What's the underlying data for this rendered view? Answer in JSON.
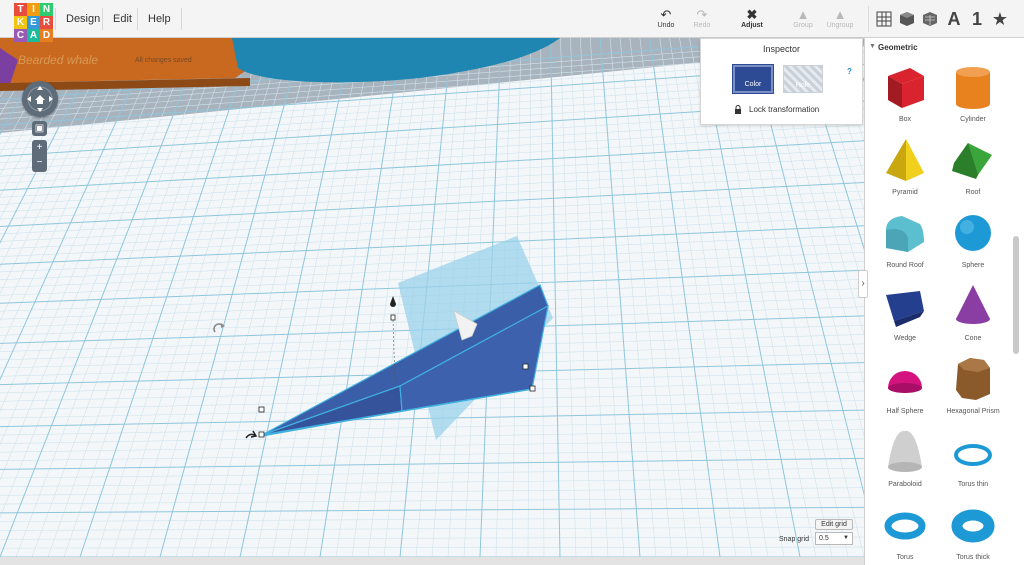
{
  "app": {
    "logo_letters": [
      "T",
      "I",
      "N",
      "K",
      "E",
      "R",
      "C",
      "A",
      "D"
    ],
    "logo_colors": [
      "#e74c3c",
      "#f39c12",
      "#2ecc71",
      "#f1c40f",
      "#3498db",
      "#e74c3c",
      "#9b59b6",
      "#1abc9c",
      "#e67e22"
    ]
  },
  "menu": {
    "design": "Design",
    "edit": "Edit",
    "help": "Help"
  },
  "toolbar": {
    "undo": "Undo",
    "redo": "Redo",
    "adjust": "Adjust",
    "group": "Group",
    "ungroup": "Ungroup",
    "letters_label": "A",
    "numbers_label": "1"
  },
  "project": {
    "title": "Bearded whale",
    "save_status": "All changes saved"
  },
  "inspector": {
    "title": "Inspector",
    "color_label": "Color",
    "hole_label": "Hole",
    "help": "?",
    "lock_label": "Lock transformation",
    "selected_color": "#2d4a95"
  },
  "grid": {
    "edit_label": "Edit grid",
    "snap_label": "Snap grid",
    "snap_value": "0.5"
  },
  "panel": {
    "section_title": "Geometric",
    "shapes": [
      {
        "name": "Box",
        "icon": "box-icon",
        "color": "#d9232e"
      },
      {
        "name": "Cylinder",
        "icon": "cylinder-icon",
        "color": "#e8821f"
      },
      {
        "name": "Pyramid",
        "icon": "pyramid-icon",
        "color": "#f1cf1d"
      },
      {
        "name": "Roof",
        "icon": "roof-icon",
        "color": "#3aa53a"
      },
      {
        "name": "Round Roof",
        "icon": "round-roof-icon",
        "color": "#5cbfd0"
      },
      {
        "name": "Sphere",
        "icon": "sphere-icon",
        "color": "#1d9ad6"
      },
      {
        "name": "Wedge",
        "icon": "wedge-icon",
        "color": "#253f8f"
      },
      {
        "name": "Cone",
        "icon": "cone-icon",
        "color": "#8a3da3"
      },
      {
        "name": "Half Sphere",
        "icon": "half-sphere-icon",
        "color": "#d4137f"
      },
      {
        "name": "Hexagonal Prism",
        "icon": "hexagonal-prism-icon",
        "color": "#8b5a2b"
      },
      {
        "name": "Paraboloid",
        "icon": "paraboloid-icon",
        "color": "#cfcfcf"
      },
      {
        "name": "Torus thin",
        "icon": "torus-thin-icon",
        "color": "#1d9ad6"
      },
      {
        "name": "Torus",
        "icon": "torus-icon",
        "color": "#1d9ad6"
      },
      {
        "name": "Torus thick",
        "icon": "torus-thick-icon",
        "color": "#1d9ad6"
      }
    ]
  }
}
